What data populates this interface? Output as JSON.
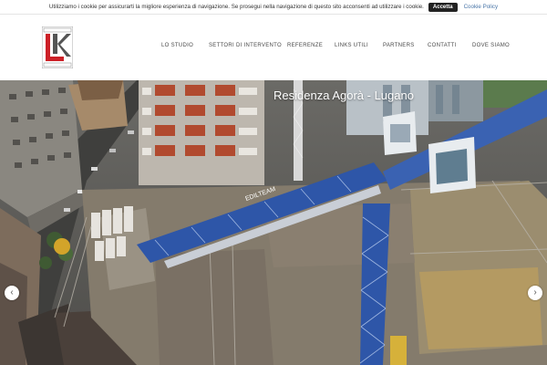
{
  "cookie_bar": {
    "text": "Utilizziamo i cookie per assicurarti la migliore esperienza di navigazione. Se prosegui nella navigazione di questo sito acconsenti ad utilizzare i cookie.",
    "accept_label": "Accetta",
    "policy_label": "Cookie Policy"
  },
  "logo": {
    "icon": "company-logo-icon",
    "top_text": "",
    "bottom_text": ""
  },
  "nav": {
    "items": [
      {
        "label": "LO STUDIO"
      },
      {
        "label": "SETTORI DI INTERVENTO"
      },
      {
        "label": "REFERENZE"
      },
      {
        "label": "LINKS UTILI"
      },
      {
        "label": "PARTNERS"
      },
      {
        "label": "CONTATTI"
      },
      {
        "label": "DOVE SIAMO"
      }
    ]
  },
  "hero": {
    "title": "Residenza Agorà - Lugano",
    "crane_label": "EDILTEAM",
    "prev_icon": "chevron-left-icon",
    "next_icon": "chevron-right-icon"
  },
  "colors": {
    "crane_blue": "#2e56a8",
    "logo_red": "#cc2027",
    "nav_text": "#4a4a4a",
    "accept_bg": "#222222"
  }
}
